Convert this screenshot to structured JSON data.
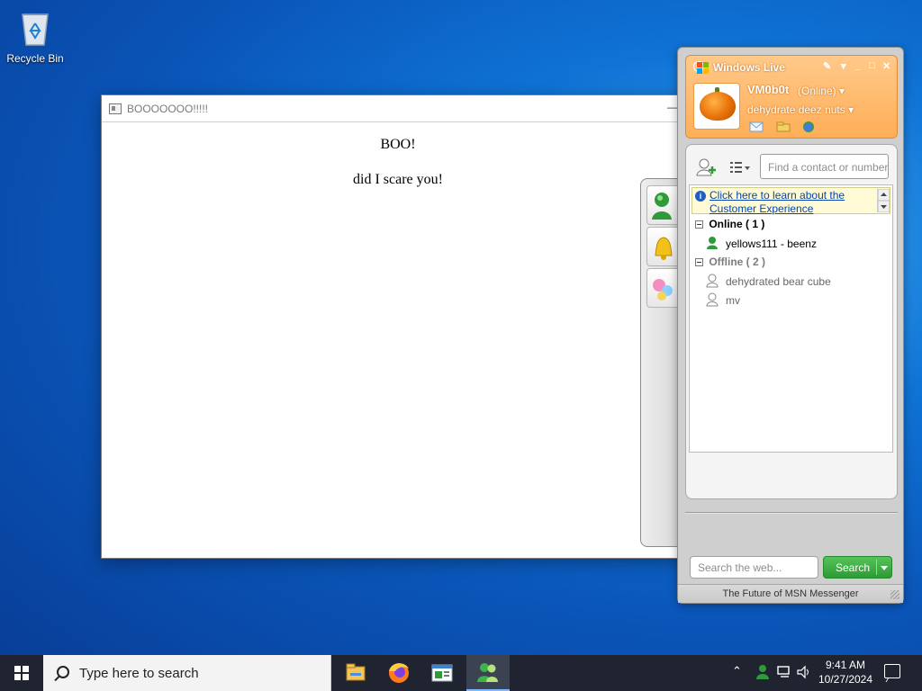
{
  "desktop": {
    "recycle_bin_label": "Recycle Bin"
  },
  "boo_window": {
    "title": "BOOOOOOO!!!!!",
    "heading": "BOO!",
    "message": "did I scare you!"
  },
  "messenger": {
    "brand": "Windows Live",
    "username": "VM0b0t",
    "status": "(Online)",
    "personal_message": "dehydrate deez nuts",
    "find_placeholder": "Find a contact or number...",
    "ticker_text": "Click here to learn about the Customer Experience",
    "groups": [
      {
        "label": "Online ( 1 )",
        "contacts": [
          {
            "name": "yellows111 - beenz",
            "status": "online"
          }
        ]
      },
      {
        "label": "Offline ( 2 )",
        "contacts": [
          {
            "name": "dehydrated bear cube",
            "status": "offline"
          },
          {
            "name": "mv",
            "status": "offline"
          }
        ]
      }
    ],
    "web_search_placeholder": "Search the web...",
    "search_button_label": "Search",
    "footer": "The Future of MSN Messenger",
    "colors": {
      "header_orange": "#ffae57",
      "search_green": "#2d9a35",
      "link_blue": "#0645ad"
    }
  },
  "taskbar": {
    "search_placeholder": "Type here to search",
    "apps": [
      "file-explorer",
      "firefox",
      "document-viewer",
      "windows-live-messenger"
    ],
    "time": "9:41 AM",
    "date": "10/27/2024"
  }
}
